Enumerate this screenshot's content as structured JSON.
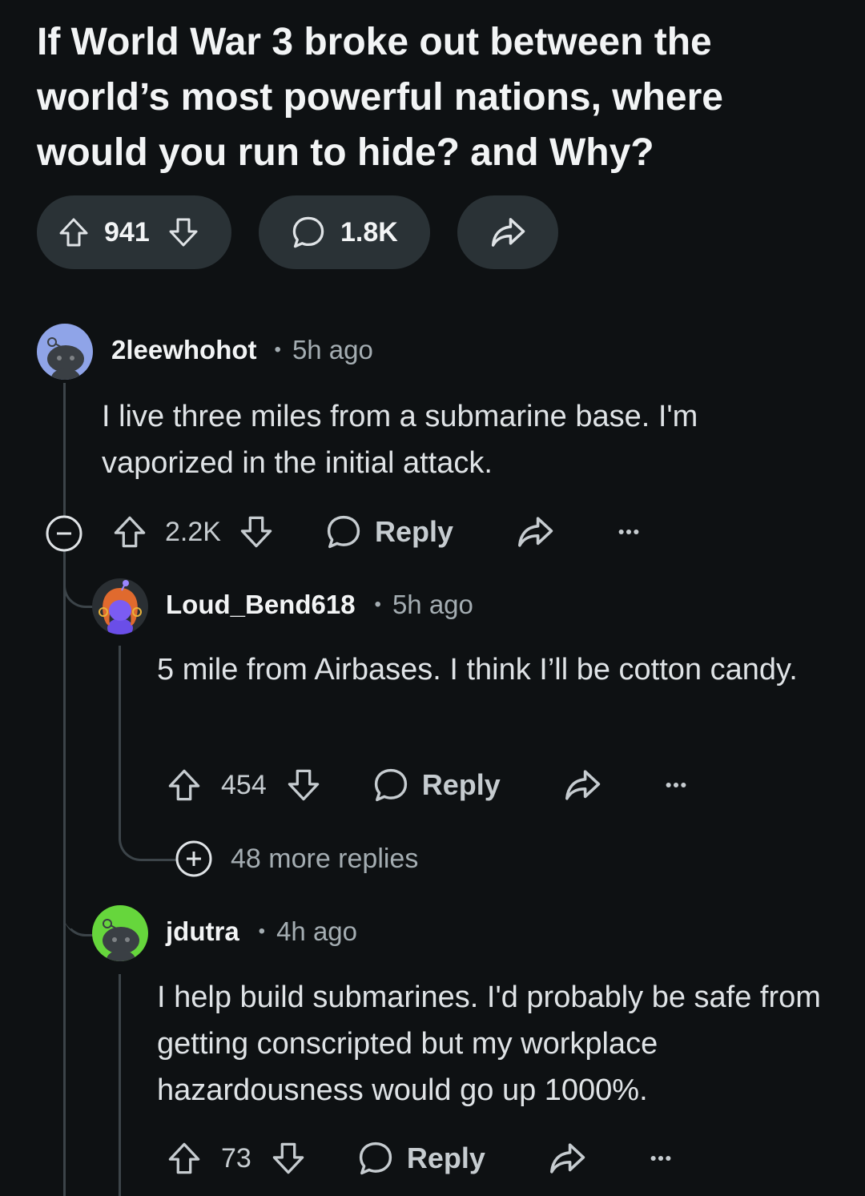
{
  "post": {
    "title": "If World War 3 broke out between the world’s most powerful nations, where would you run to hide? and Why?",
    "votes": "941",
    "comments": "1.8K"
  },
  "comments": [
    {
      "username": "2leewhohot",
      "time": "5h ago",
      "body": "I live three miles from a submarine base. I'm vaporized in the initial attack.",
      "votes": "2.2K",
      "reply_label": "Reply",
      "avatar_color": "#8fa4e8"
    },
    {
      "username": "Loud_Bend618",
      "time": "5h ago",
      "body": "5 mile from Airbases. I think I’ll be cotton candy.",
      "votes": "454",
      "reply_label": "Reply",
      "more_replies": "48 more replies",
      "avatar_color": "#2a2f33"
    },
    {
      "username": "jdutra",
      "time": "4h ago",
      "body": "I help build submarines. I'd probably be safe from getting conscripted but my workplace hazardousness would go up 1000%.",
      "votes": "73",
      "reply_label": "Reply",
      "avatar_color": "#66d63c"
    }
  ],
  "icons": {
    "upvote": "upvote-icon",
    "downvote": "downvote-icon",
    "comment": "comment-icon",
    "share": "share-icon",
    "more": "more-options-icon",
    "collapse": "collapse-icon",
    "expand": "expand-icon"
  }
}
